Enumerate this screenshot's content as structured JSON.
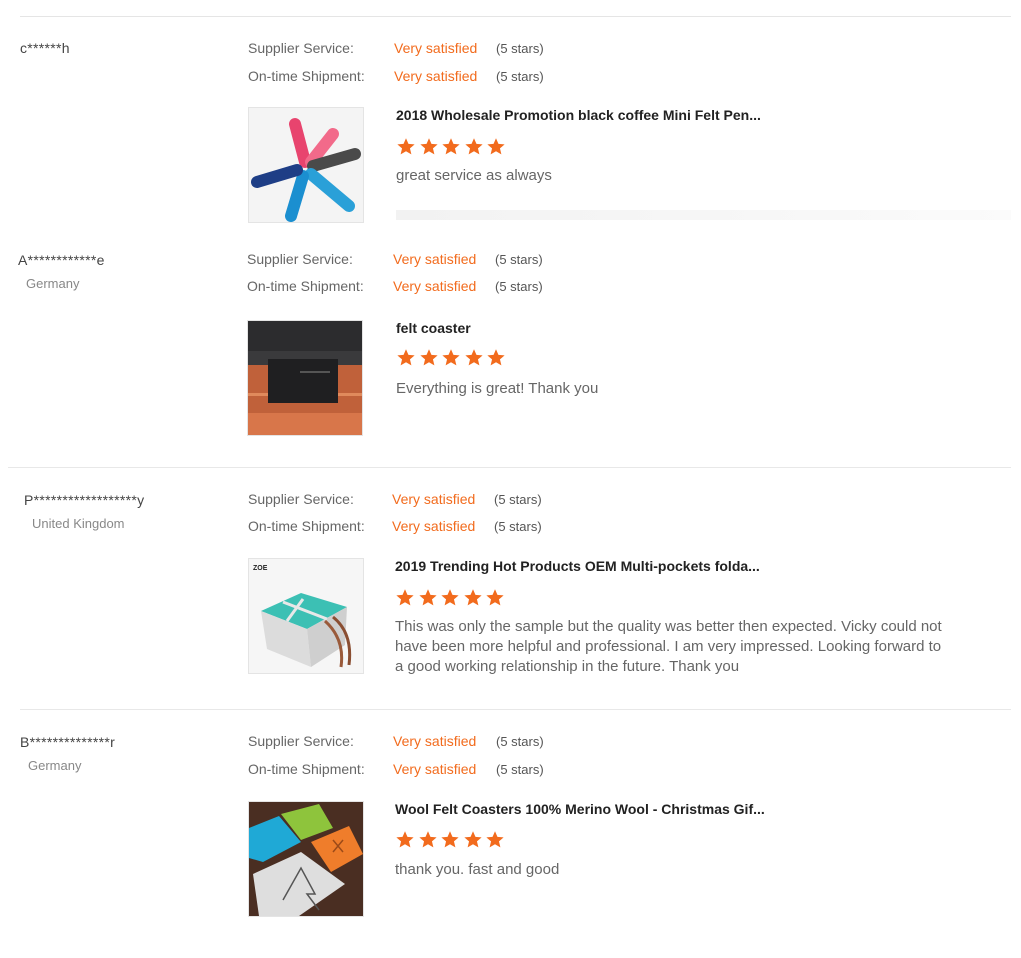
{
  "labels": {
    "supplier_service": "Supplier Service:",
    "ontime_shipment": "On-time Shipment:"
  },
  "colors": {
    "accent": "#f26b1d",
    "star": "#f26b1d"
  },
  "reviews": [
    {
      "buyer": "c******h",
      "country": "",
      "supplier_service": "Very satisfied",
      "supplier_stars": "(5 stars)",
      "shipment": "Very satisfied",
      "shipment_stars": "(5 stars)",
      "product_title": "2018 Wholesale Promotion black coffee Mini Felt Pen...",
      "product_image": "felt-keychain-strips-image",
      "rating": 5,
      "comment": "great service as always"
    },
    {
      "buyer": "A************e",
      "country": "Germany",
      "supplier_service": "Very satisfied",
      "supplier_stars": "(5 stars)",
      "shipment": "Very satisfied",
      "shipment_stars": "(5 stars)",
      "product_title": "felt coaster",
      "product_image": "black-felt-coaster-image",
      "rating": 5,
      "comment": "Everything is great! Thank you"
    },
    {
      "buyer": "P******************y",
      "country": "United Kingdom",
      "supplier_service": "Very satisfied",
      "supplier_stars": "(5 stars)",
      "shipment": "Very satisfied",
      "shipment_stars": "(5 stars)",
      "product_title": "2019 Trending Hot Products OEM Multi-pockets folda...",
      "product_image": "felt-caddy-organizer-image",
      "product_image_text": "ZOE",
      "rating": 5,
      "comment": "This was only the sample but the quality was better then expected. Vicky could not have been more helpful and professional. I am very impressed. Looking forward to a good working relationship in the future. Thank you"
    },
    {
      "buyer": "B**************r",
      "country": "Germany",
      "supplier_service": "Very satisfied",
      "supplier_stars": "(5 stars)",
      "shipment": "Very satisfied",
      "shipment_stars": "(5 stars)",
      "product_title": "Wool Felt Coasters 100% Merino Wool - Christmas Gif...",
      "product_image": "wool-felt-coasters-image",
      "rating": 5,
      "comment": "thank you. fast and good"
    }
  ]
}
